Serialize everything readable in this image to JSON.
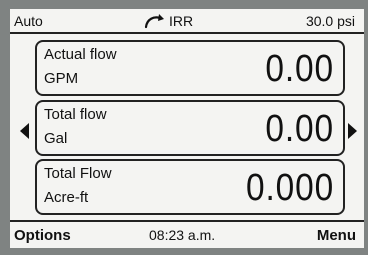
{
  "status": {
    "mode": "Auto",
    "irr_label": "IRR",
    "pressure": "30.0 psi"
  },
  "cards": [
    {
      "label_top": "Actual flow",
      "label_bottom": "GPM",
      "value": "0.00"
    },
    {
      "label_top": "Total flow",
      "label_bottom": "Gal",
      "value": "0.00"
    },
    {
      "label_top": "Total Flow",
      "label_bottom": "Acre-ft",
      "value": "0.000"
    }
  ],
  "footer": {
    "options": "Options",
    "time": "08:23 a.m.",
    "menu": "Menu"
  },
  "icons": {
    "status_arrow": "curved-arrow-icon",
    "left": "left-arrow-icon",
    "right": "right-arrow-icon"
  }
}
